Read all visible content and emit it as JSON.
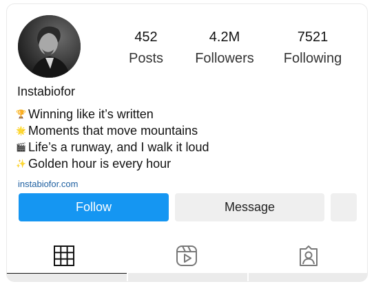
{
  "profile": {
    "username": "Instabiofor",
    "link": "instabiofor.com"
  },
  "stats": {
    "posts": {
      "value": "452",
      "label": "Posts"
    },
    "followers": {
      "value": "4.2M",
      "label": "Followers"
    },
    "following": {
      "value": "7521",
      "label": "Following"
    }
  },
  "bio": [
    {
      "emoji": "🏆",
      "text": "Winning like it’s written"
    },
    {
      "emoji": "🌟",
      "text": "Moments that move mountains"
    },
    {
      "emoji": "🎬",
      "text": "Life’s a runway, and I walk it loud"
    },
    {
      "emoji": "✨",
      "text": "Golden hour is every hour"
    }
  ],
  "actions": {
    "follow_label": "Follow",
    "message_label": "Message"
  },
  "tabs": [
    {
      "name": "posts",
      "icon": "grid-icon",
      "active": true
    },
    {
      "name": "reels",
      "icon": "reels-icon",
      "active": false
    },
    {
      "name": "tagged",
      "icon": "tagged-icon",
      "active": false
    }
  ],
  "colors": {
    "follow_button": "#1596f2",
    "secondary_button": "#efefef",
    "link": "#1d5fa0"
  }
}
